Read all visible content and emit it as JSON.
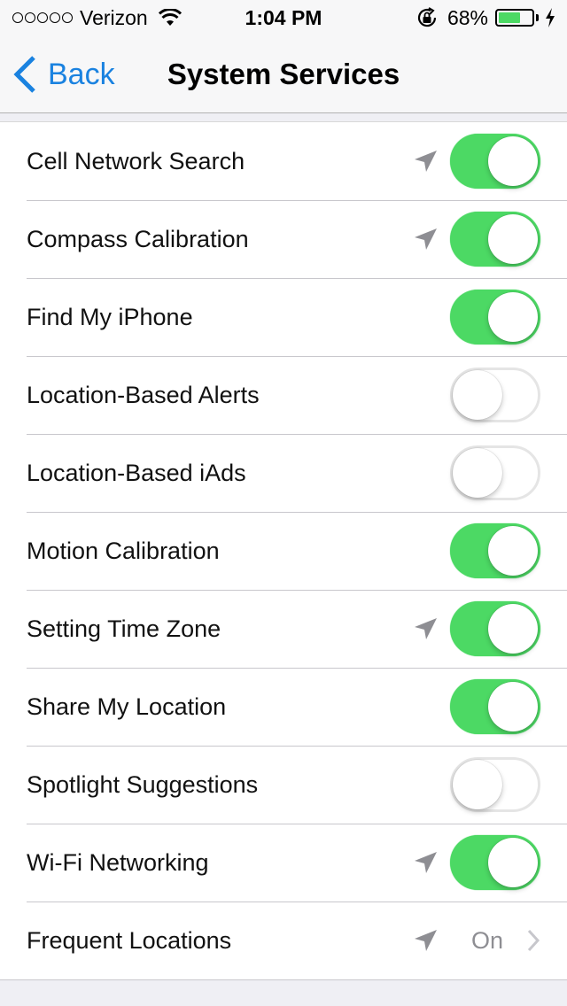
{
  "status_bar": {
    "signal_dots": 5,
    "carrier": "Verizon",
    "wifi_icon": "wifi-icon",
    "time": "1:04 PM",
    "rotation_lock_icon": "rotation-lock-icon",
    "battery_percent_label": "68%",
    "battery_level": 0.68,
    "charging_icon": "bolt-icon",
    "battery_color": "#4cd964"
  },
  "nav": {
    "back_label": "Back",
    "title": "System Services",
    "accent_color": "#1a82e0"
  },
  "rows": [
    {
      "label": "Cell Network Search",
      "location_arrow": true,
      "type": "toggle",
      "on": true
    },
    {
      "label": "Compass Calibration",
      "location_arrow": true,
      "type": "toggle",
      "on": true
    },
    {
      "label": "Find My iPhone",
      "location_arrow": false,
      "type": "toggle",
      "on": true
    },
    {
      "label": "Location-Based Alerts",
      "location_arrow": false,
      "type": "toggle",
      "on": false
    },
    {
      "label": "Location-Based iAds",
      "location_arrow": false,
      "type": "toggle",
      "on": false
    },
    {
      "label": "Motion Calibration",
      "location_arrow": false,
      "type": "toggle",
      "on": true
    },
    {
      "label": "Setting Time Zone",
      "location_arrow": true,
      "type": "toggle",
      "on": true
    },
    {
      "label": "Share My Location",
      "location_arrow": false,
      "type": "toggle",
      "on": true
    },
    {
      "label": "Spotlight Suggestions",
      "location_arrow": false,
      "type": "toggle",
      "on": false
    },
    {
      "label": "Wi-Fi Networking",
      "location_arrow": true,
      "type": "toggle",
      "on": true
    },
    {
      "label": "Frequent Locations",
      "location_arrow": true,
      "type": "disclosure",
      "value": "On"
    }
  ],
  "colors": {
    "toggle_on": "#4cd964",
    "location_arrow": "#8e8e93"
  }
}
